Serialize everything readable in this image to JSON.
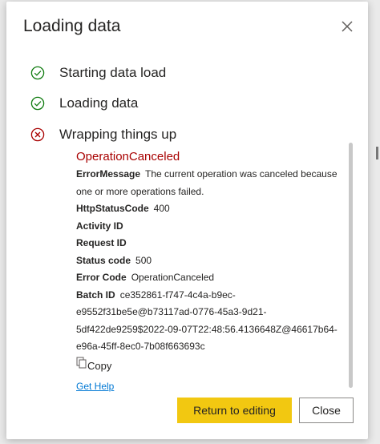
{
  "dialog": {
    "title": "Loading data",
    "steps": [
      {
        "label": "Starting data load",
        "status": "success"
      },
      {
        "label": "Loading data",
        "status": "success"
      },
      {
        "label": "Wrapping things up",
        "status": "error"
      }
    ],
    "error": {
      "title": "OperationCanceled",
      "fields": {
        "error_message_key": "ErrorMessage",
        "error_message_val": "The current operation was canceled because",
        "error_message_cont": "one or more operations failed.",
        "http_status_key": "HttpStatusCode",
        "http_status_val": "400",
        "activity_id_key": "Activity ID",
        "request_id_key": "Request ID",
        "status_code_key": "Status code",
        "status_code_val": "500",
        "error_code_key": "Error Code",
        "error_code_val": "OperationCanceled",
        "batch_id_key": "Batch ID",
        "batch_id_line1": "ce352861-f747-4c4a-b9ec-",
        "batch_id_line2": "e9552f31be5e@b73117ad-0776-45a3-9d21-",
        "batch_id_line3": "5df422de9259$2022-09-07T22:48:56.4136648Z@46617b64-",
        "batch_id_line4": "e96a-45ff-8ec0-7b08f663693c"
      },
      "copy_label": "Copy",
      "help_link": "Get Help"
    },
    "buttons": {
      "return": "Return to editing",
      "close": "Close"
    }
  },
  "colors": {
    "success": "#107c10",
    "error": "#a80000",
    "primary_button": "#f2c811",
    "link": "#0078d4"
  },
  "icons": {
    "success": "check-circle-icon",
    "error": "x-circle-icon",
    "close": "close-icon",
    "copy": "copy-icon"
  }
}
